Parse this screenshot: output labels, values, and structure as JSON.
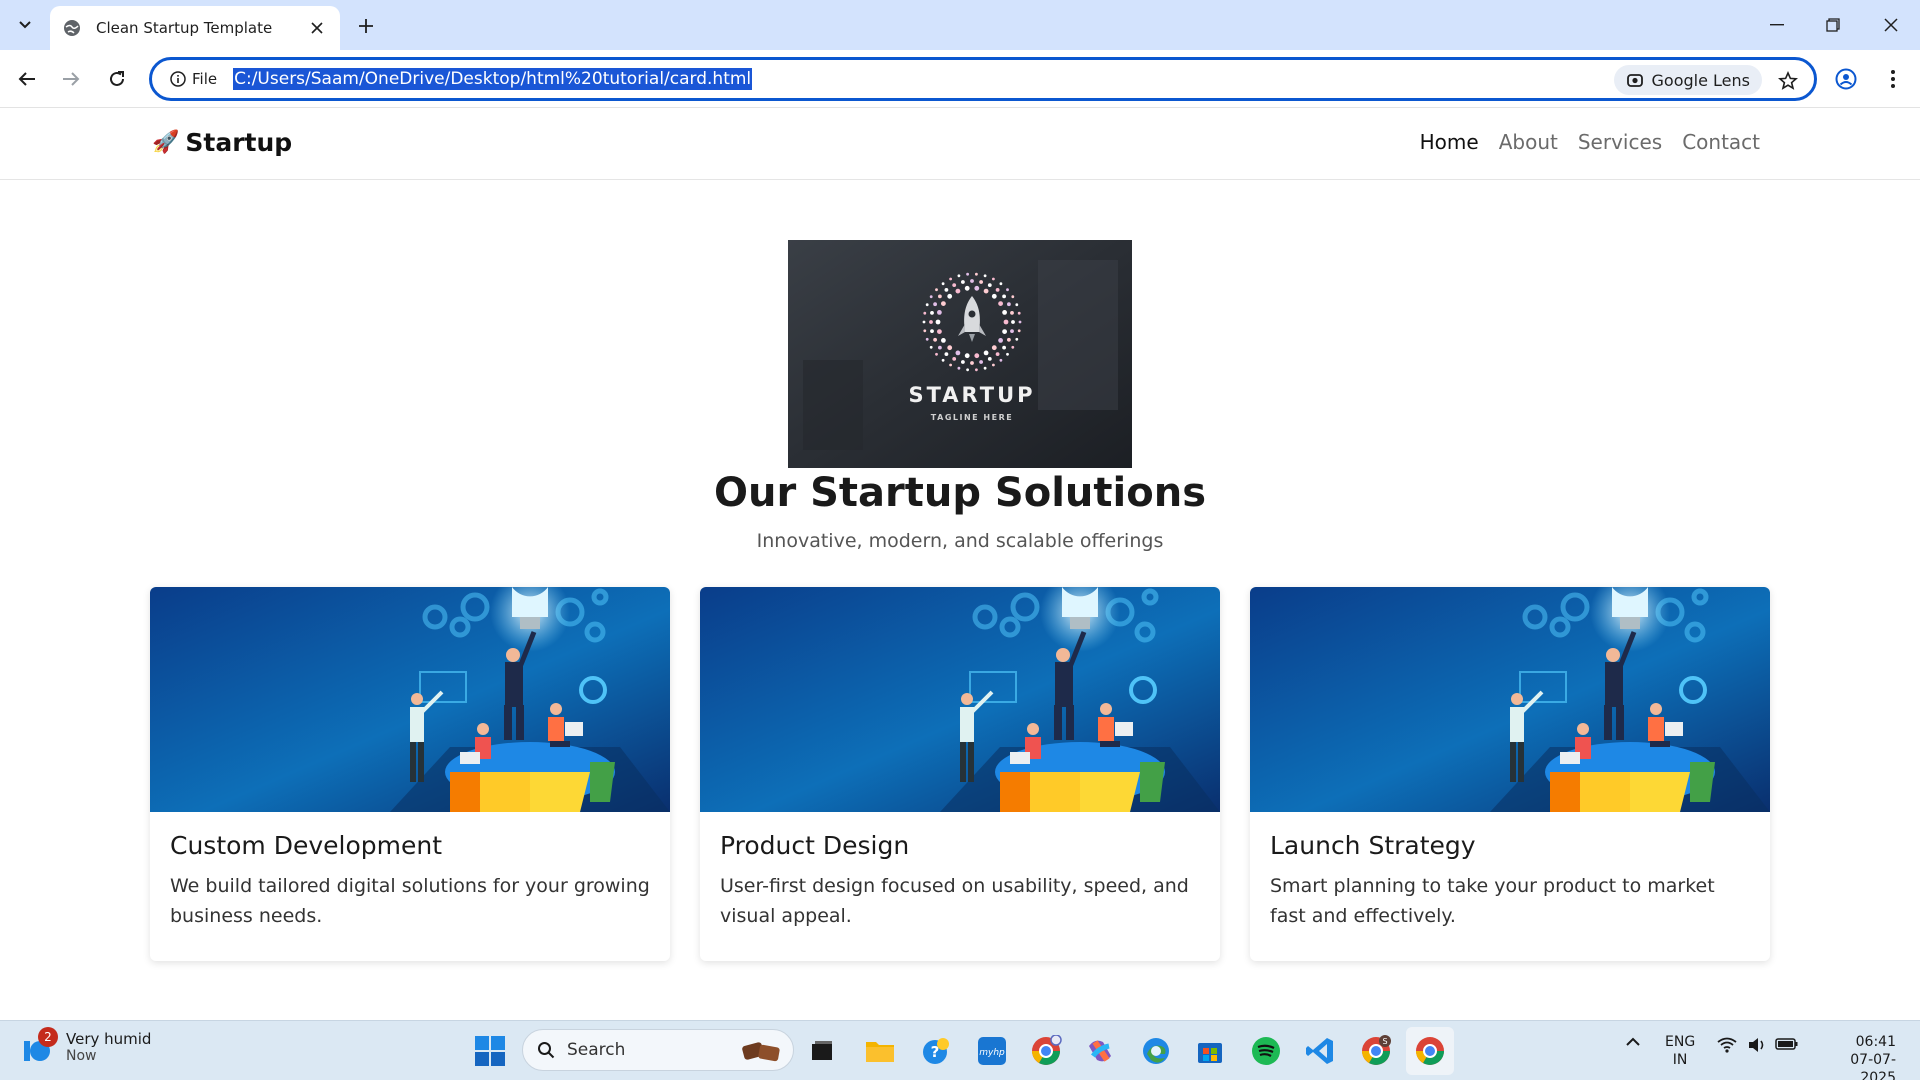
{
  "browser": {
    "tab_title": "Clean Startup Template",
    "site_info_label": "File",
    "url": "C:/Users/Saam/OneDrive/Desktop/html%20tutorial/card.html",
    "lens_label": "Google Lens"
  },
  "site": {
    "brand": "Startup",
    "nav": [
      "Home",
      "About",
      "Services",
      "Contact"
    ],
    "active_nav": "Home",
    "logo": {
      "name": "STARTUP",
      "tagline": "TAGLINE HERE"
    },
    "hero_title": "Our Startup Solutions",
    "hero_subtitle": "Innovative, modern, and scalable offerings",
    "cards": [
      {
        "title": "Custom Development",
        "text": "We build tailored digital solutions for your growing business needs."
      },
      {
        "title": "Product Design",
        "text": "User-first design focused on usability, speed, and visual appeal."
      },
      {
        "title": "Launch Strategy",
        "text": "Smart planning to take your product to market fast and effectively."
      }
    ]
  },
  "taskbar": {
    "weather_title": "Very humid",
    "weather_time": "Now",
    "weather_badge": "2",
    "search_placeholder": "Search",
    "lang_top": "ENG",
    "lang_bottom": "IN",
    "time": "06:41",
    "date": "07-07-2025"
  },
  "colors": {
    "accent": "#0b57d0",
    "tabstrip": "#d3e3fd",
    "taskbar": "#dbe8f3"
  }
}
